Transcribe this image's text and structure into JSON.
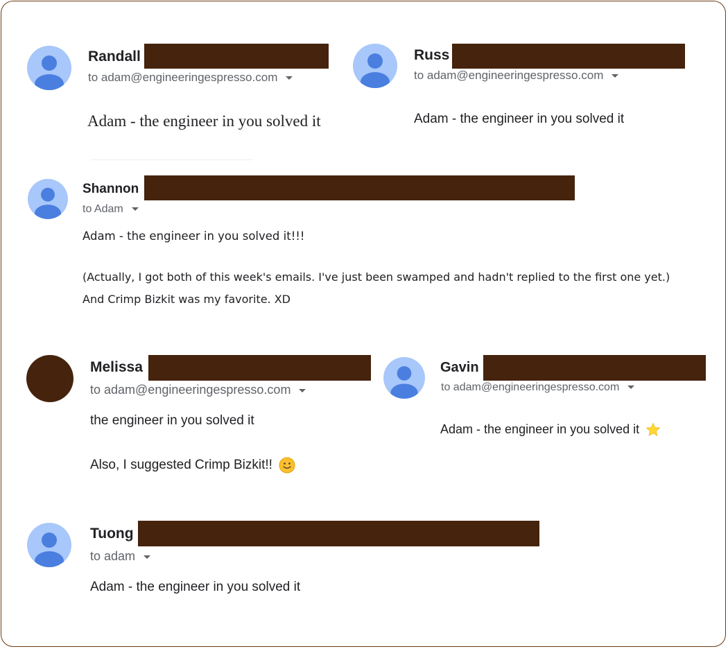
{
  "messages": [
    {
      "sender": "Randall",
      "to": "to adam@engineeringespresso.com",
      "body": [
        "Adam - the engineer in you solved it"
      ]
    },
    {
      "sender": "Russ",
      "to": "to adam@engineeringespresso.com",
      "body": [
        "Adam - the engineer in you solved it"
      ]
    },
    {
      "sender": "Shannon",
      "to": "to Adam",
      "body": [
        "Adam - the engineer in you solved it!!!",
        "(Actually, I got both of this week's emails. I've just been swamped and hadn't replied to the first one yet.)",
        "And Crimp Bizkit was my favorite. XD"
      ]
    },
    {
      "sender": "Melissa",
      "to": "to adam@engineeringespresso.com",
      "body": [
        "the engineer in you solved it",
        "Also, I suggested Crimp Bizkit!!"
      ]
    },
    {
      "sender": "Gavin",
      "to": "to adam@engineeringespresso.com",
      "body": [
        "Adam - the engineer in you solved it"
      ]
    },
    {
      "sender": "Tuong",
      "to": "to adam",
      "body": [
        "Adam - the engineer in you solved it"
      ]
    }
  ],
  "colors": {
    "frame": "#6b3a12",
    "redaction": "#45230d",
    "avatar": "#a8c7fa",
    "avatar_figure": "#4a7fe0"
  },
  "icons": {
    "avatar": "person-icon",
    "dropdown": "caret-down-icon",
    "smile": "smile-emoji-icon",
    "star": "star-emoji-icon"
  }
}
